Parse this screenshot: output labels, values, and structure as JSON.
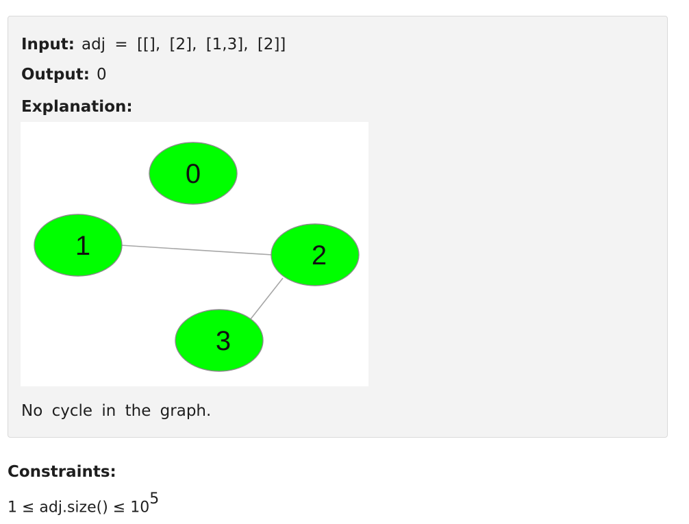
{
  "example": {
    "input_label": "Input:",
    "input_value": "adj = [[], [2], [1,3], [2]]",
    "output_label": "Output:",
    "output_value": "0",
    "explanation_label": "Explanation:",
    "graph": {
      "node_color": "#00ff00",
      "edge_color": "#a6a6a6",
      "nodes": [
        "0",
        "1",
        "2",
        "3"
      ],
      "edges": [
        [
          "1",
          "2"
        ],
        [
          "2",
          "3"
        ]
      ]
    },
    "note": "No cycle in the graph."
  },
  "constraints": {
    "title": "Constraints:",
    "text": "1 ≤ adj.size() ≤ 10",
    "exponent": "5"
  }
}
